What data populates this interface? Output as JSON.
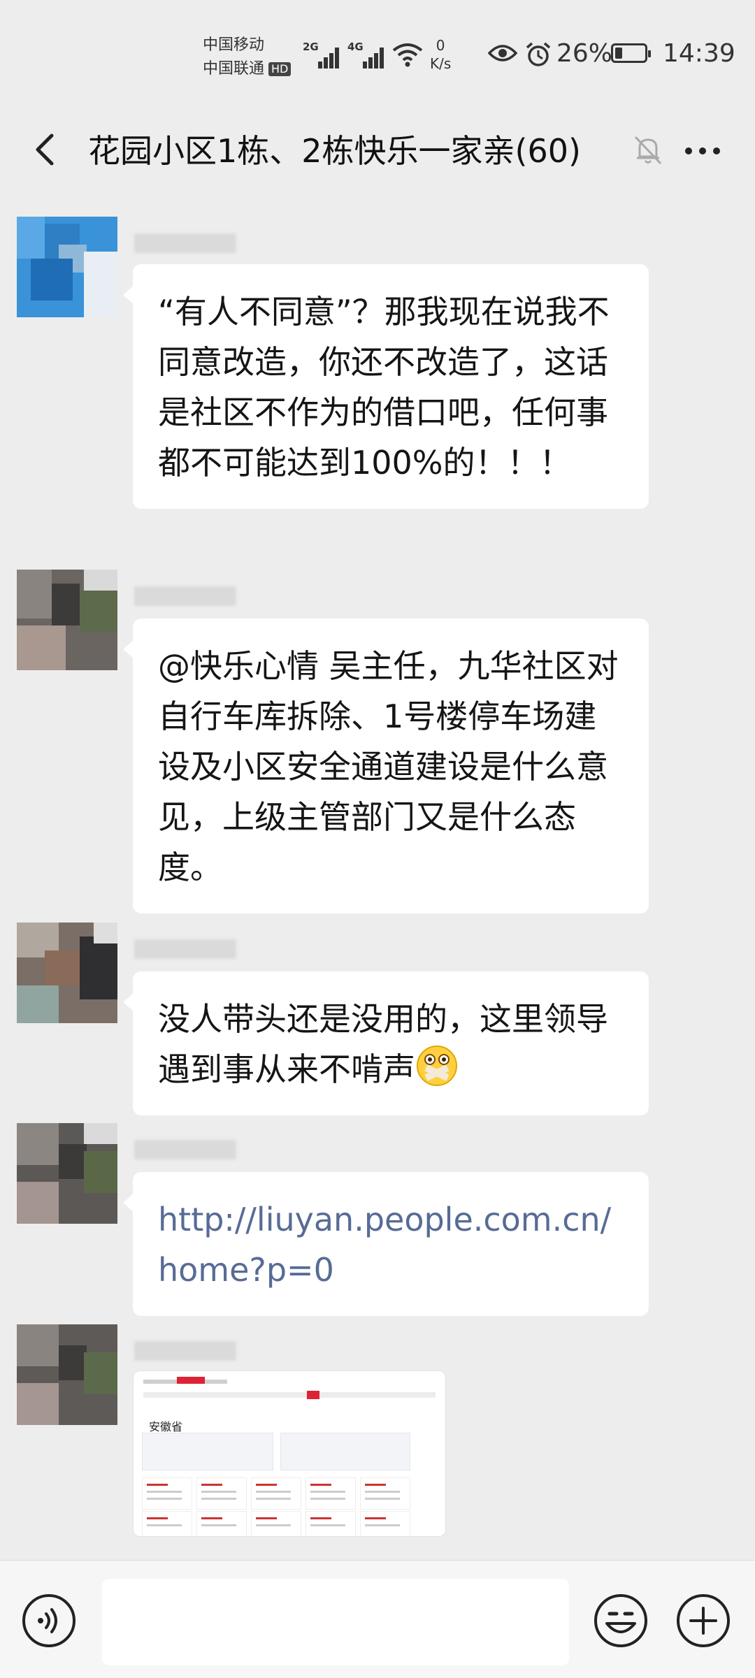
{
  "status_bar": {
    "carrier1": "中国移动",
    "carrier2": "中国联通",
    "hd_badge": "HD",
    "net1": "2G",
    "net2": "4G",
    "speed_value": "0",
    "speed_unit": "K/s",
    "battery_percent": "26%",
    "battery_level": 0.26,
    "time": "14:39"
  },
  "chat": {
    "title": "花园小区1栋、2栋快乐一家亲(60)",
    "icons": {
      "back": "back-arrow-icon",
      "mute": "muted-bell-icon",
      "more": "more-dots-icon"
    }
  },
  "messages": [
    {
      "type": "text",
      "text": "“有人不同意”？那我现在说我不同意改造，你还不改造了，这话是社区不作为的借口吧，任何事都不可能达到100%的！！！"
    },
    {
      "type": "text",
      "text": "@快乐心情  吴主任，九华社区对自行车库拆除、1号楼停车场建设及小区安全通道建设是什么意见，上级主管部门又是什么态度。"
    },
    {
      "type": "text",
      "text": "没人带头还是没用的，这里领导遇到事从来不啃声",
      "emoji": "silenced-face-emoji"
    },
    {
      "type": "link",
      "text": "http://liuyan.people.com.cn/home?p=0"
    },
    {
      "type": "image",
      "caption": "安徽省"
    }
  ],
  "input_bar": {
    "placeholder": "",
    "icons": {
      "voice": "voice-icon",
      "emoji": "emoji-smile-icon",
      "plus": "plus-icon"
    }
  },
  "colors": {
    "background": "#ededed",
    "bubble": "#ffffff",
    "link": "#576b95"
  }
}
